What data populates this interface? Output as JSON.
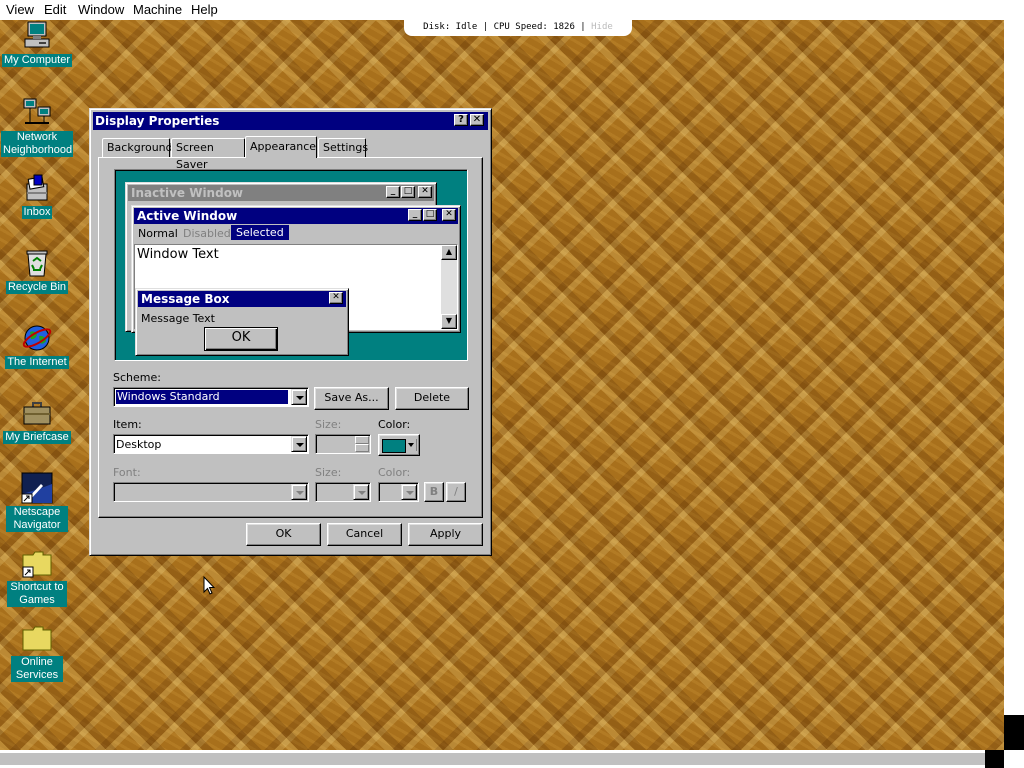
{
  "host": {
    "menu": [
      "View",
      "Edit",
      "Window",
      "Machine",
      "Help"
    ],
    "status_text": "Disk: Idle | CPU Speed: 1826 |",
    "hide_label": "Hide"
  },
  "desktop_icons": [
    {
      "label": "My Computer",
      "icon": "computer-icon"
    },
    {
      "label": "Network Neighborhood",
      "icon": "network-icon"
    },
    {
      "label": "Inbox",
      "icon": "inbox-icon"
    },
    {
      "label": "Recycle Bin",
      "icon": "recycle-bin-icon"
    },
    {
      "label": "The Internet",
      "icon": "internet-icon"
    },
    {
      "label": "My Briefcase",
      "icon": "briefcase-icon"
    },
    {
      "label": "Netscape Navigator",
      "icon": "netscape-icon"
    },
    {
      "label": "Shortcut to Games",
      "icon": "folder-shortcut-icon"
    },
    {
      "label": "Online Services",
      "icon": "folder-icon"
    }
  ],
  "dialog": {
    "title": "Display Properties",
    "help_btn": "?",
    "close_btn": "✕",
    "tabs": [
      "Background",
      "Screen Saver",
      "Appearance",
      "Settings"
    ],
    "active_tab": "Appearance",
    "preview": {
      "inactive_title": "Inactive Window",
      "active_title": "Active Window",
      "menu_normal": "Normal",
      "menu_disabled": "Disabled",
      "menu_selected": "Selected",
      "window_text": "Window Text",
      "msgbox_title": "Message Box",
      "msgbox_text": "Message Text",
      "msgbox_ok": "OK"
    },
    "scheme_label": "Scheme:",
    "scheme_value": "Windows Standard",
    "save_as_label": "Save As...",
    "delete_label": "Delete",
    "item_label": "Item:",
    "item_value": "Desktop",
    "size_label": "Size:",
    "color_label": "Color:",
    "color_value": "#008080",
    "font_label": "Font:",
    "font_size_label": "Size:",
    "font_color_label": "Color:",
    "bold_label": "B",
    "italic_label": "/",
    "ok_label": "OK",
    "cancel_label": "Cancel",
    "apply_label": "Apply"
  },
  "colors": {
    "titlebar_active": "#000080",
    "titlebar_inactive": "#808080",
    "desktop_teal": "#008080",
    "face": "#c0c0c0"
  }
}
